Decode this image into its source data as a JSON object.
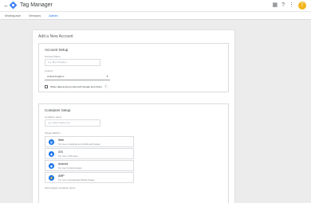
{
  "header": {
    "back_icon": "arrow-left-icon",
    "logo_icon": "tag-manager-diamond-icon",
    "app_title": "Tag Manager",
    "icons": [
      "apps-grid-icon",
      "help-icon",
      "more-vert-icon"
    ],
    "avatar_initial": "T"
  },
  "tabs": [
    {
      "label": "Workspace",
      "active": false
    },
    {
      "label": "Versions",
      "active": false
    },
    {
      "label": "Admin",
      "active": true
    }
  ],
  "page": {
    "title": "Add a New Account"
  },
  "account_setup": {
    "title": "Account Setup",
    "account_name_label": "Account Name",
    "account_name_placeholder": "e.g. My Company",
    "country_label": "Country",
    "country_value": "United Kingdom",
    "share_label": "Share data anonymously with Google and others"
  },
  "container_setup": {
    "title": "Container Setup",
    "container_name_label": "Container name",
    "container_name_placeholder": "e.g. www.mysite.com",
    "target_platform_label": "Target platform",
    "platforms": [
      {
        "name": "Web",
        "desc": "For use on desktop and mobile web pages",
        "icon": "globe-icon"
      },
      {
        "name": "iOS",
        "desc": "For use in iOS apps",
        "icon": "apple-icon"
      },
      {
        "name": "Android",
        "desc": "For use in Android apps",
        "icon": "android-icon"
      },
      {
        "name": "AMP",
        "desc": "For use in Accelerated Mobile Pages",
        "icon": "amp-icon"
      }
    ],
    "footer": "Show legacy container types"
  },
  "colors": {
    "accent": "#1a73e8",
    "logo": "#4285f4",
    "avatar": "#f2b51c",
    "background": "#ececec"
  }
}
